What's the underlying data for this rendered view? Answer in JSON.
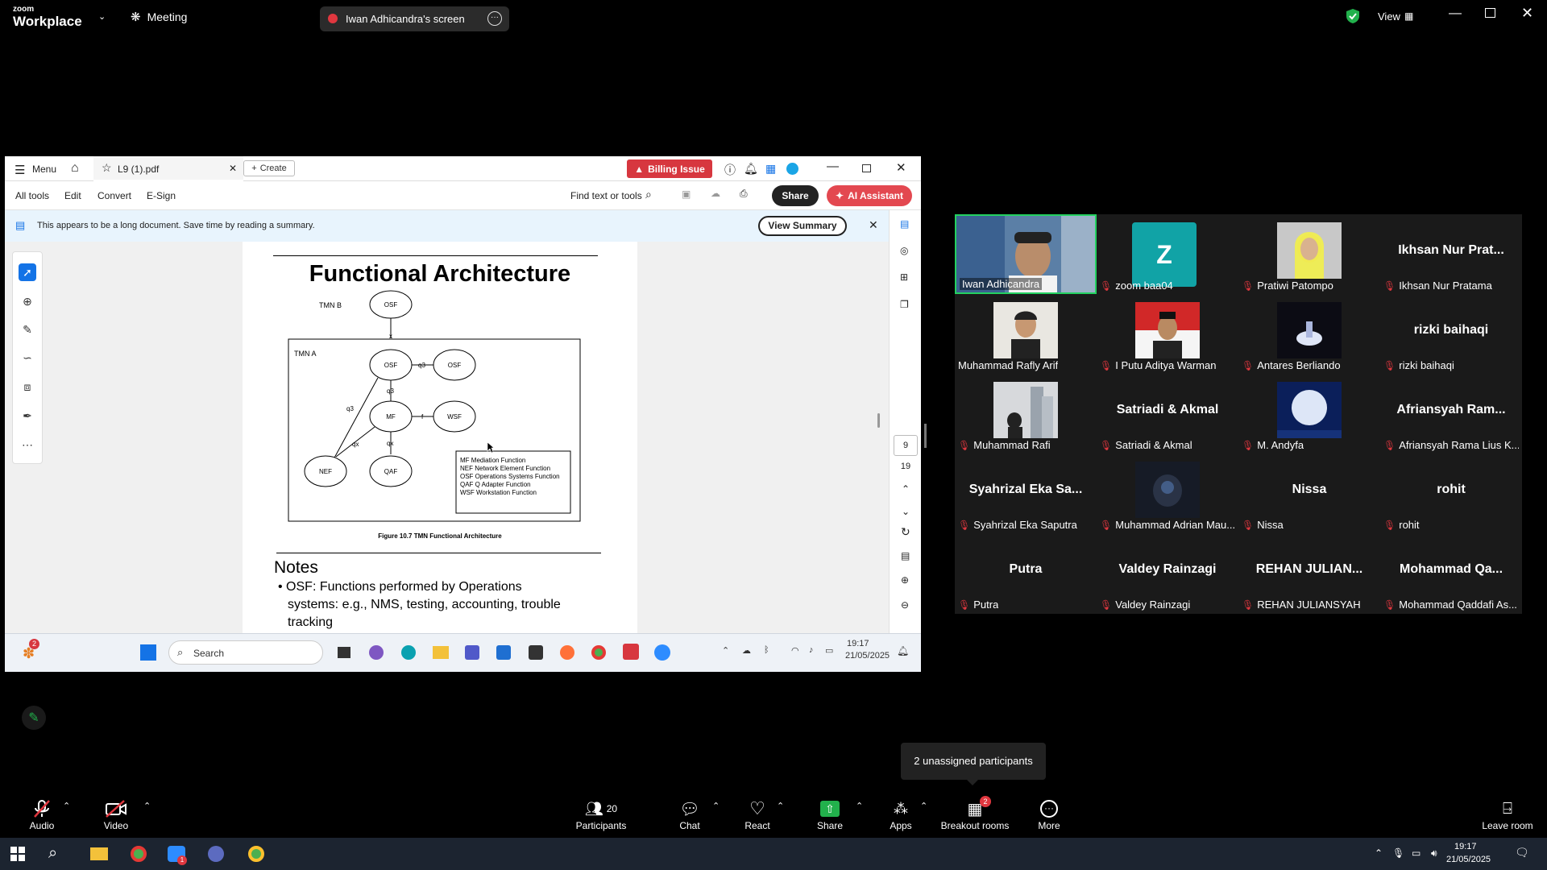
{
  "zoom": {
    "logo_small": "zoom",
    "logo_big": "Workplace",
    "meeting_label": "Meeting",
    "screen_label": "Iwan Adhicandra's screen",
    "view_label": "View"
  },
  "acrobat": {
    "menu_label": "Menu",
    "tab_title": "L9 (1).pdf",
    "create_label": "Create",
    "billing_label": "Billing Issue",
    "tools": [
      "All tools",
      "Edit",
      "Convert",
      "E-Sign"
    ],
    "find_label": "Find text or tools",
    "share_label": "Share",
    "ai_label": "AI Assistant",
    "banner_text": "This appears to be a long document. Save time by reading a summary.",
    "view_summary_label": "View Summary",
    "page_current": "9",
    "page_total": "19"
  },
  "slide": {
    "title": "Functional Architecture",
    "figure_caption": "Figure 10.7  TMN Functional Architecture",
    "notes_heading": "Notes",
    "note_bullet": "• OSF: Functions performed by Operations",
    "note_line2": "systems: e.g., NMS, testing, accounting, trouble",
    "note_line3": "tracking",
    "diagram": {
      "tmn_b": "TMN B",
      "tmn_a": "TMN A",
      "osf": "OSF",
      "mf": "MF",
      "wsf": "WSF",
      "nef": "NEF",
      "qaf": "QAF",
      "x": "x",
      "q3": "q3",
      "f": "f",
      "qx": "qx",
      "legend": [
        "MF   Mediation Function",
        "NEF  Network Element Function",
        "OSF  Operations Systems Function",
        "QAF  Q Adapter Function",
        "WSF  Workstation Function"
      ]
    }
  },
  "inner_taskbar": {
    "search_label": "Search",
    "badge": "2",
    "time": "19:17",
    "date": "21/05/2025"
  },
  "participants": [
    {
      "name": "Iwan Adhicandra",
      "big": "",
      "kind": "video-man",
      "muted": false,
      "active": true
    },
    {
      "name": "zoom baa04",
      "big": "",
      "kind": "avatar-z",
      "avatar_letter": "Z",
      "muted": true
    },
    {
      "name": "Pratiwi Patompo",
      "big": "",
      "kind": "video-woman",
      "muted": true
    },
    {
      "name": "Ikhsan Nur Pratama",
      "big": "Ikhsan Nur Prat...",
      "kind": "name",
      "muted": true
    },
    {
      "name": "Muhammad Rafly Arif",
      "big": "",
      "kind": "video-boy",
      "muted": false
    },
    {
      "name": "I Putu Aditya Warman",
      "big": "",
      "kind": "video-flag",
      "muted": true
    },
    {
      "name": "Antares Berliando",
      "big": "",
      "kind": "video-dark",
      "muted": true
    },
    {
      "name": "rizki baihaqi",
      "big": "rizki baihaqi",
      "kind": "name",
      "muted": true
    },
    {
      "name": "Muhammad Rafi",
      "big": "",
      "kind": "video-city",
      "muted": true
    },
    {
      "name": "Satriadi & Akmal",
      "big": "Satriadi & Akmal",
      "kind": "name",
      "muted": true
    },
    {
      "name": "M. Andyfa",
      "big": "",
      "kind": "video-moon",
      "muted": true
    },
    {
      "name": "Afriansyah Rama Lius K...",
      "big": "Afriansyah Ram...",
      "kind": "name",
      "muted": true
    },
    {
      "name": "Syahrizal Eka Saputra",
      "big": "Syahrizal Eka Sa...",
      "kind": "name",
      "muted": true
    },
    {
      "name": "Muhammad Adrian Mau...",
      "big": "",
      "kind": "video-night",
      "muted": true
    },
    {
      "name": "Nissa",
      "big": "Nissa",
      "kind": "name",
      "muted": true
    },
    {
      "name": "rohit",
      "big": "rohit",
      "kind": "name",
      "muted": true
    },
    {
      "name": "Putra",
      "big": "Putra",
      "kind": "name",
      "muted": true
    },
    {
      "name": "Valdey Rainzagi",
      "big": "Valdey Rainzagi",
      "kind": "name",
      "muted": true
    },
    {
      "name": "REHAN JULIANSYAH",
      "big": "REHAN JULIAN...",
      "kind": "name",
      "muted": true
    },
    {
      "name": "Mohammad Qaddafi As...",
      "big": "Mohammad Qa...",
      "kind": "name",
      "muted": true
    }
  ],
  "tooltip": "2 unassigned participants",
  "bottombar": {
    "audio": "Audio",
    "video": "Video",
    "participants": "Participants",
    "participants_count": "20",
    "chat": "Chat",
    "react": "React",
    "share": "Share",
    "apps": "Apps",
    "breakout": "Breakout rooms",
    "breakout_badge": "2",
    "more": "More",
    "leave": "Leave room"
  },
  "wintask": {
    "time": "19:17",
    "date": "21/05/2025",
    "chat_badge": "1"
  },
  "colors": {
    "accent_green": "#22b14c",
    "muted_red": "#e0373f",
    "active_border": "#23d160",
    "ai_red": "#e34850"
  }
}
